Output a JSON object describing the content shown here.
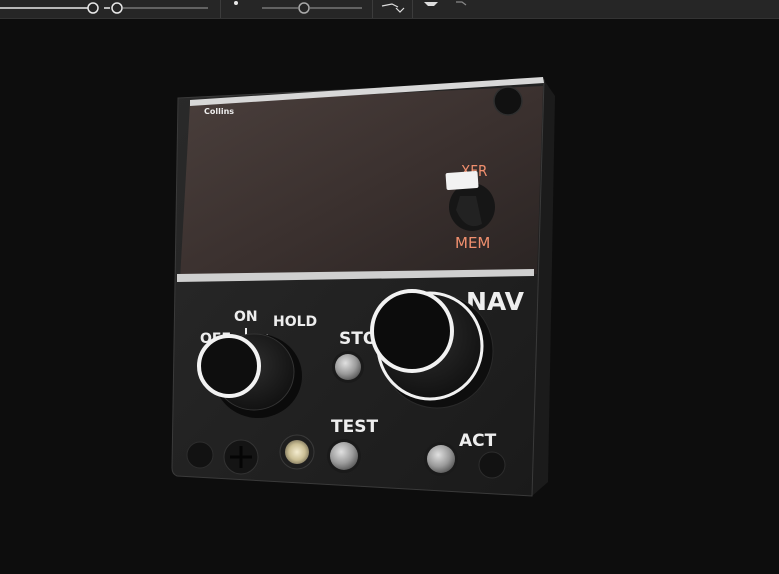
{
  "toolbar": {
    "slider1_icon": "range-slider-icon",
    "slider2_icon": "range-slider-icon",
    "slider3_icon": "range-slider-icon",
    "view_icon": "camera-orbit-icon",
    "dropdown_icon": "chevron-down-icon",
    "shading_icon": "shading-mode-icon",
    "visibility_icon": "visibility-toggle-icon"
  },
  "panel": {
    "brand": "Collins",
    "xfr_label": "XFR",
    "mem_label": "MEM",
    "nav_label": "NAV",
    "off_label": "OFF",
    "on_label": "ON",
    "hold_label": "HOLD",
    "sto_label": "STO",
    "test_label": "TEST",
    "act_label": "ACT"
  },
  "colors": {
    "accent_label": "#f08f6e",
    "text_white": "#eeeeee",
    "panel_dark": "#202020",
    "display_glass": "#3e3431"
  }
}
